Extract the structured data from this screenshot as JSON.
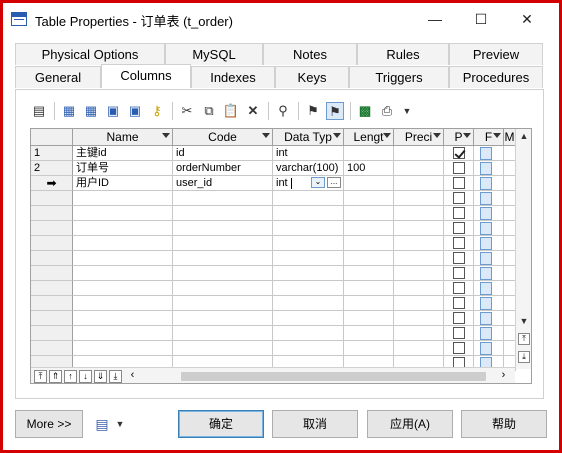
{
  "window": {
    "title": "Table Properties - 订单表 (t_order)",
    "minimize": "—",
    "maximize": "☐",
    "close": "✕"
  },
  "tabs_row1": [
    "Physical Options",
    "MySQL",
    "Notes",
    "Rules",
    "Preview"
  ],
  "tabs_row2": [
    "General",
    "Columns",
    "Indexes",
    "Keys",
    "Triggers",
    "Procedures"
  ],
  "active_tab": "Columns",
  "grid": {
    "headers": [
      "Name",
      "Code",
      "Data Typ",
      "Lengt",
      "Preci",
      "P",
      "F",
      "M"
    ],
    "rows": [
      {
        "num": "1",
        "name": "主键id",
        "code": "id",
        "type": "int",
        "length": "",
        "precision": "",
        "p": true
      },
      {
        "num": "2",
        "name": "订单号",
        "code": "orderNumber",
        "type": "varchar(100)",
        "length": "100",
        "precision": "",
        "p": false
      },
      {
        "num": "➡",
        "name": "用户ID",
        "code": "user_id",
        "type": "int",
        "length": "",
        "precision": "",
        "p": false
      }
    ],
    "combo_more": "..."
  },
  "buttons": {
    "more": "More >>",
    "ok": "确定",
    "cancel": "取消",
    "apply": "应用(A)",
    "help": "帮助"
  }
}
